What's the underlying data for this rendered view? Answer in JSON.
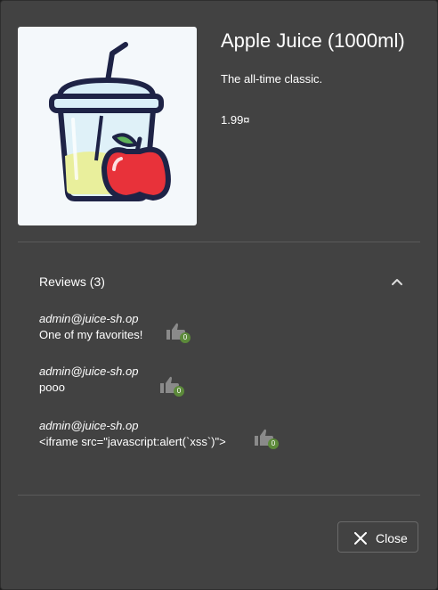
{
  "product": {
    "name": "Apple Juice (1000ml)",
    "description": "The all-time classic.",
    "price": "1.99¤"
  },
  "reviews": {
    "title": "Reviews (3)",
    "items": [
      {
        "author": "admin@juice-sh.op",
        "message": "One of my favorites!",
        "likes": "0"
      },
      {
        "author": "admin@juice-sh.op",
        "message": "pooo",
        "likes": "0"
      },
      {
        "author": "admin@juice-sh.op",
        "message": "<iframe src=\"javascript:alert(`xss`)\">",
        "likes": "0"
      }
    ]
  },
  "actions": {
    "close_label": "Close"
  },
  "icons": {
    "product_image": "apple-juice-cup-icon",
    "collapse": "chevron-up-icon",
    "like": "thumbs-up-icon",
    "close": "close-icon"
  },
  "colors": {
    "dialog_bg": "#424242",
    "like_badge": "#5c8a3a"
  }
}
